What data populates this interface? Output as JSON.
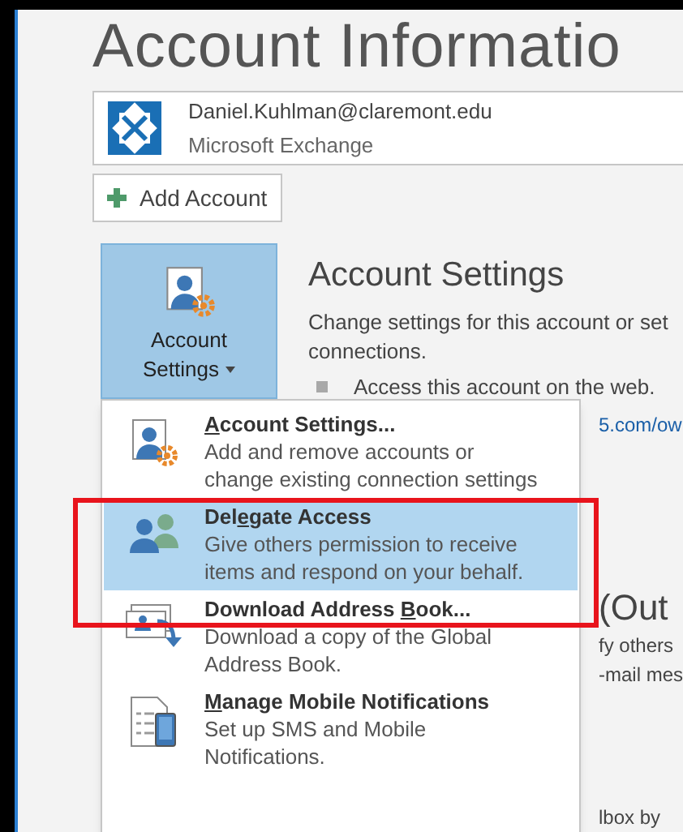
{
  "page_title": "Account Informatio",
  "account": {
    "email": "Daniel.Kuhlman@claremont.edu",
    "type": "Microsoft Exchange"
  },
  "add_account_button": "Add Account",
  "settings_button": {
    "line1": "Account",
    "line2": "Settings",
    "expanded": true
  },
  "section": {
    "heading": "Account Settings",
    "description": "Change settings for this account or set",
    "description_2": "connections.",
    "bullet": "Access this account on the web."
  },
  "peeking_texts": [
    {
      "text": "5.com/ow",
      "kind": "link"
    },
    {
      "text": "(Out",
      "kind": "heading"
    },
    {
      "text": "fy others",
      "kind": "body"
    },
    {
      "text": "-mail mes",
      "kind": "body"
    },
    {
      "text": "lbox by",
      "kind": "body"
    }
  ],
  "menu": [
    {
      "kind": "settings",
      "title": [
        {
          "text": "A",
          "underline": true
        },
        {
          "text": "ccount Settings...",
          "underline": false
        }
      ],
      "lines": [
        "Add and remove accounts or",
        "change existing connection settings"
      ],
      "selected": false
    },
    {
      "kind": "delegate",
      "title": [
        {
          "text": "Del",
          "underline": false
        },
        {
          "text": "e",
          "underline": true
        },
        {
          "text": "gate Access",
          "underline": false
        }
      ],
      "lines": [
        "Give others permission to receive",
        "items and respond on your behalf."
      ],
      "selected": true
    },
    {
      "kind": "addressbook",
      "title": [
        {
          "text": "Download Address ",
          "underline": false
        },
        {
          "text": "B",
          "underline": true
        },
        {
          "text": "ook...",
          "underline": false
        }
      ],
      "lines": [
        "Download a copy of the Global",
        "Address Book."
      ],
      "selected": false
    },
    {
      "kind": "mobile",
      "title": [
        {
          "text": "M",
          "underline": true
        },
        {
          "text": "anage Mobile Notifications",
          "underline": false
        }
      ],
      "lines": [
        "Set up SMS and Mobile",
        "Notifications."
      ],
      "selected": false
    }
  ]
}
